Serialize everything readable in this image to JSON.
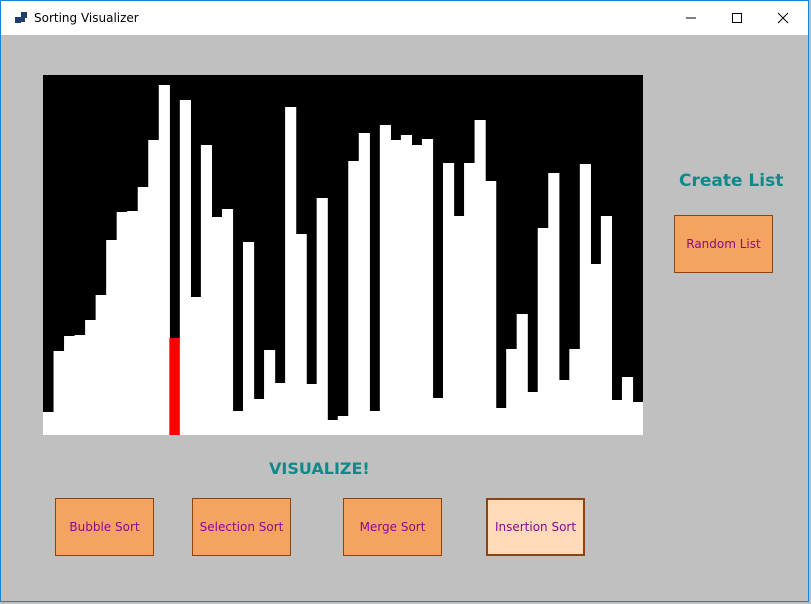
{
  "window": {
    "title": "Sorting Visualizer"
  },
  "headings": {
    "create_list": "Create List",
    "visualize": "VISUALIZE!"
  },
  "buttons": {
    "random_list": "Random List",
    "bubble_sort": "Bubble Sort",
    "selection_sort": "Selection Sort",
    "merge_sort": "Merge Sort",
    "insertion_sort": "Insertion Sort"
  },
  "colors": {
    "bar": "#ffffff",
    "highlight": "#ff0000",
    "canvas": "#000000",
    "heading": "#0f8a8a",
    "button": "#f4a460",
    "button_active": "#ffdab9",
    "button_text": "#8b0a8b"
  },
  "bars": {
    "max": 360,
    "highlight_index": 12,
    "values": [
      23,
      84,
      99,
      100,
      115,
      140,
      195,
      223,
      224,
      248,
      295,
      350,
      97,
      335,
      138,
      290,
      218,
      226,
      24,
      193,
      36,
      85,
      52,
      328,
      201,
      51,
      237,
      15,
      19,
      274,
      302,
      24,
      310,
      295,
      300,
      290,
      296,
      37,
      272,
      219,
      272,
      315,
      254,
      27,
      86,
      121,
      43,
      207,
      262,
      55,
      86,
      271,
      171,
      219,
      35,
      58,
      33
    ]
  }
}
